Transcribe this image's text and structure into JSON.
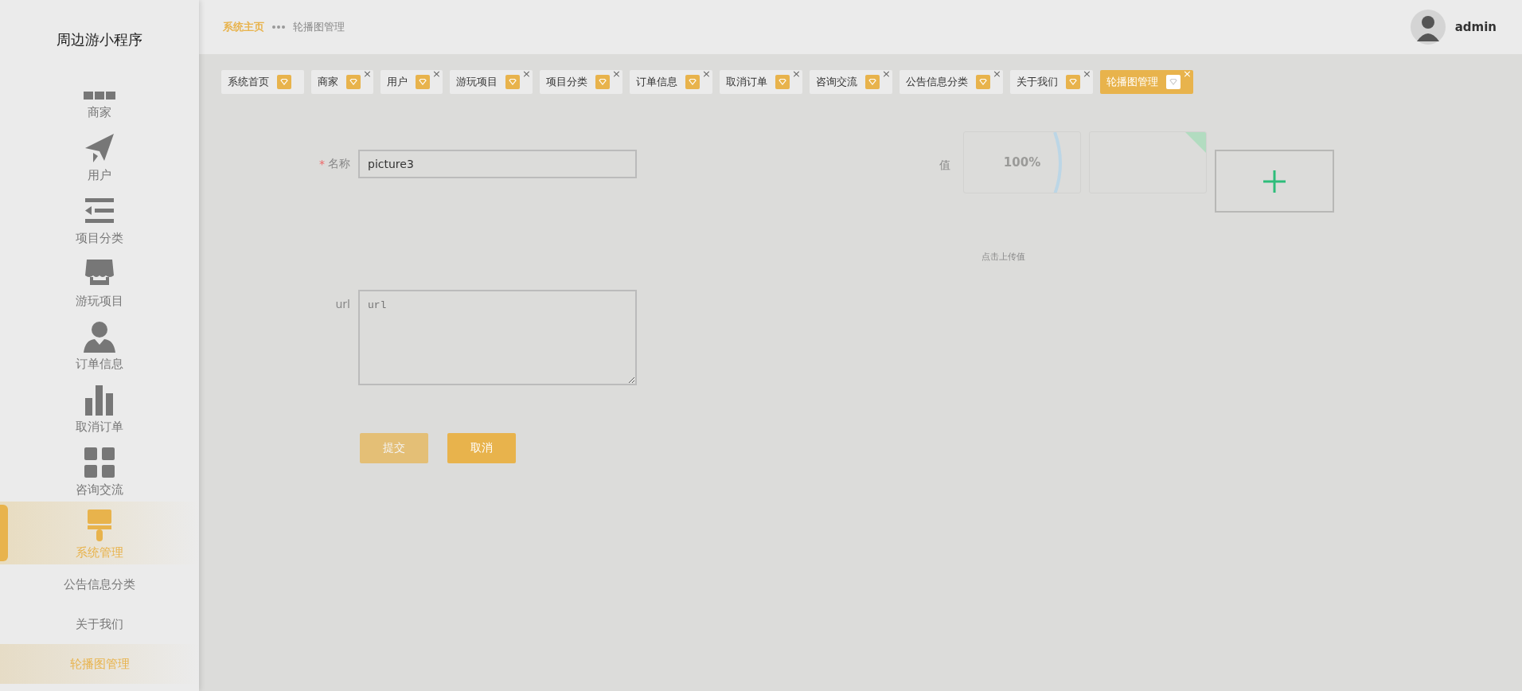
{
  "sidebar": {
    "title": "周边游小程序",
    "items": [
      {
        "label": "商家",
        "selected": false
      },
      {
        "label": "用户",
        "selected": false
      },
      {
        "label": "项目分类",
        "selected": false
      },
      {
        "label": "游玩项目",
        "selected": false
      },
      {
        "label": "订单信息",
        "selected": false
      },
      {
        "label": "取消订单",
        "selected": false
      },
      {
        "label": "咨询交流",
        "selected": false
      },
      {
        "label": "系统管理",
        "selected": true,
        "children": [
          {
            "label": "公告信息分类",
            "selected": false
          },
          {
            "label": "关于我们",
            "selected": false
          },
          {
            "label": "轮播图管理",
            "selected": true
          }
        ]
      }
    ]
  },
  "header": {
    "breadcrumb": [
      {
        "label": "系统主页",
        "selected": true
      },
      {
        "label": "轮播图管理",
        "selected": false
      }
    ],
    "user": {
      "name": "admin"
    }
  },
  "tabs": [
    {
      "label": "系统首页",
      "selected": false
    },
    {
      "label": "商家",
      "selected": false,
      "close": "×"
    },
    {
      "label": "用户",
      "selected": false,
      "close": "×"
    },
    {
      "label": "游玩项目",
      "selected": false,
      "close": "×"
    },
    {
      "label": "项目分类",
      "selected": false,
      "close": "×"
    },
    {
      "label": "订单信息",
      "selected": false,
      "close": "×"
    },
    {
      "label": "取消订单",
      "selected": false,
      "close": "×"
    },
    {
      "label": "咨询交流",
      "selected": false,
      "close": "×"
    },
    {
      "label": "公告信息分类",
      "selected": false,
      "close": "×"
    },
    {
      "label": "关于我们",
      "selected": false,
      "close": "×"
    },
    {
      "label": "轮播图管理",
      "selected": true,
      "close": "×"
    }
  ],
  "form": {
    "fields": [
      {
        "label": "名称",
        "required_mark": "*",
        "kind": "input",
        "value": "picture3"
      },
      {
        "label": "url",
        "kind": "textarea",
        "placeholder": "url"
      }
    ],
    "buttons": [
      {
        "label": "提交",
        "disabled": true
      },
      {
        "label": "取消",
        "disabled": false
      }
    ]
  },
  "upload": {
    "label": "值",
    "items": [
      {
        "kind": "progress",
        "text": "100%"
      },
      {
        "kind": "done"
      }
    ],
    "hint": "点击上传值"
  }
}
